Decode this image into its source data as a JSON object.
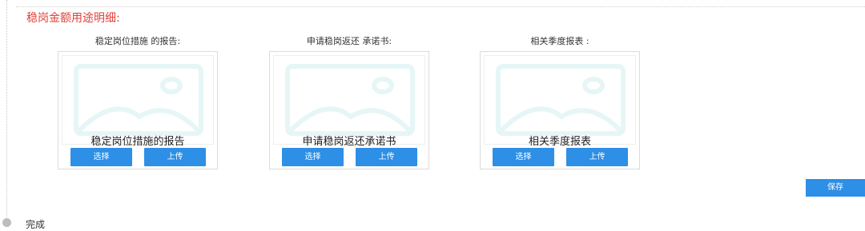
{
  "section": {
    "title": "稳岗金额用途明细:"
  },
  "panels": [
    {
      "caption": "稳定岗位措施 的报告:",
      "preview_label": "稳定岗位措施的报告",
      "select_label": "选择",
      "upload_label": "上传"
    },
    {
      "caption": "申请稳岗返还 承诺书:",
      "preview_label": "申请稳岗返还承诺书",
      "select_label": "选择",
      "upload_label": "上传"
    },
    {
      "caption": "相关季度报表 :",
      "preview_label": "相关季度报表",
      "select_label": "选择",
      "upload_label": "上传"
    }
  ],
  "save_label": "保存",
  "step": {
    "label": "完成"
  },
  "icons": {
    "placeholder": "image-placeholder-icon"
  },
  "colors": {
    "title": "#e0413a",
    "button": "#2d8fe6",
    "placeholder": "#e6f6f6"
  }
}
